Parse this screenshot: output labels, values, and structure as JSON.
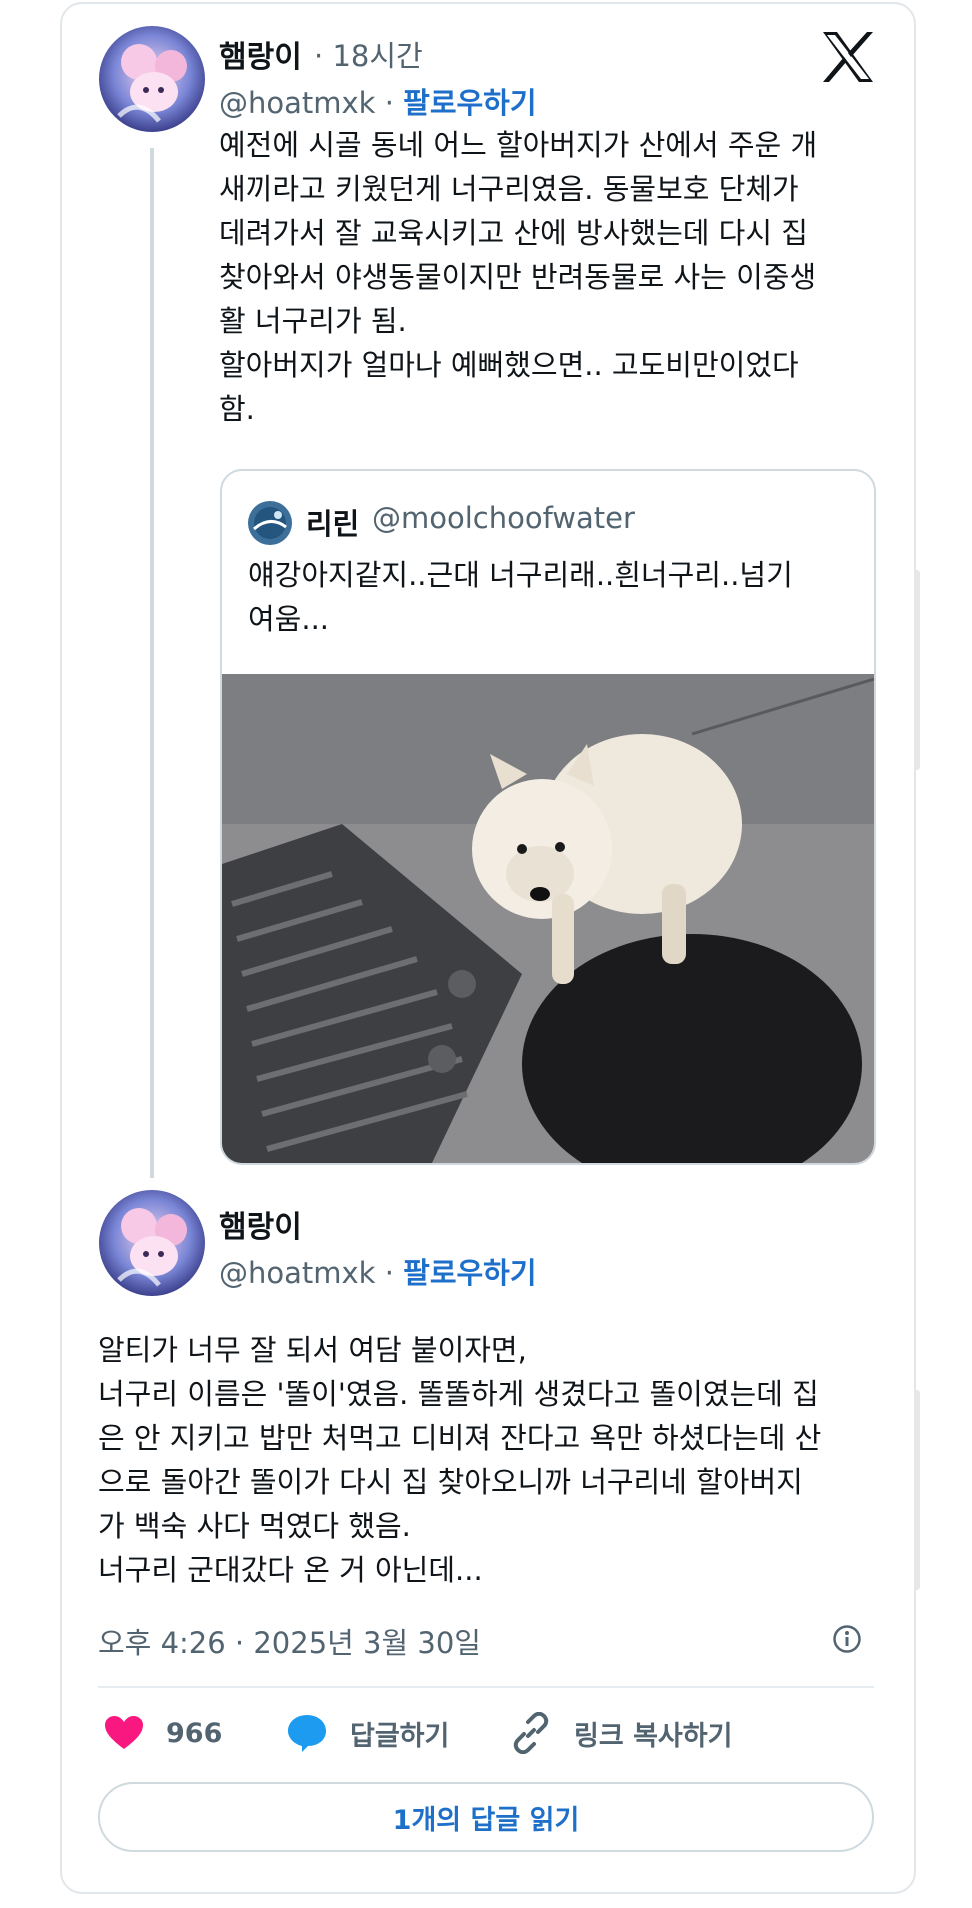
{
  "tweet": {
    "author_name": "햄랑이",
    "time_ago": "18시간",
    "handle": "@hoatmxk",
    "follow_label": "팔로우하기",
    "text": "예전에 시골 동네 어느 할아버지가 산에서 주운 개\n새끼라고 키웠던게 너구리였음. 동물보호 단체가\n데려가서 잘 교육시키고 산에 방사했는데 다시 집\n찾아와서 야생동물이지만 반려동물로 사는 이중생\n활 너구리가 됨.\n할아버지가 얼마나 예뻐했으면.. 고도비만이었다\n함."
  },
  "quote": {
    "author_name": "리린",
    "handle": "@moolchoofwater",
    "text": "얘강아지같지..근대 너구리래..흰너구리..넘기\n여움..."
  },
  "reply": {
    "author_name": "햄랑이",
    "handle": "@hoatmxk",
    "follow_label": "팔로우하기",
    "text": "알티가 너무 잘 되서 여담 붙이자면,\n너구리 이름은 '똘이'였음. 똘똘하게 생겼다고 똘이였는데 집\n은 안 지키고 밥만 처먹고 디비져 잔다고 욕만 하셨다는데 산\n으로 돌아간 똘이가 다시 집 찾아오니까 너구리네 할아버지\n가 백숙 사다 먹였다 했음.\n너구리 군대갔다 온 거 아닌데..."
  },
  "timestamp": "오후 4:26 · 2025년 3월 30일",
  "actions": {
    "like_count": "966",
    "reply_label": "답글하기",
    "copy_link_label": "링크 복사하기"
  },
  "read_replies_label": "1개의 답글 읽기",
  "colors": {
    "accent": "#1d6fc9",
    "like": "#f91880",
    "reply_icon": "#1d9bf0",
    "border": "#cfd9de",
    "muted_text": "#536471"
  },
  "icons": [
    "x-logo-icon",
    "heart-icon",
    "speech-bubble-icon",
    "link-icon",
    "info-icon"
  ]
}
